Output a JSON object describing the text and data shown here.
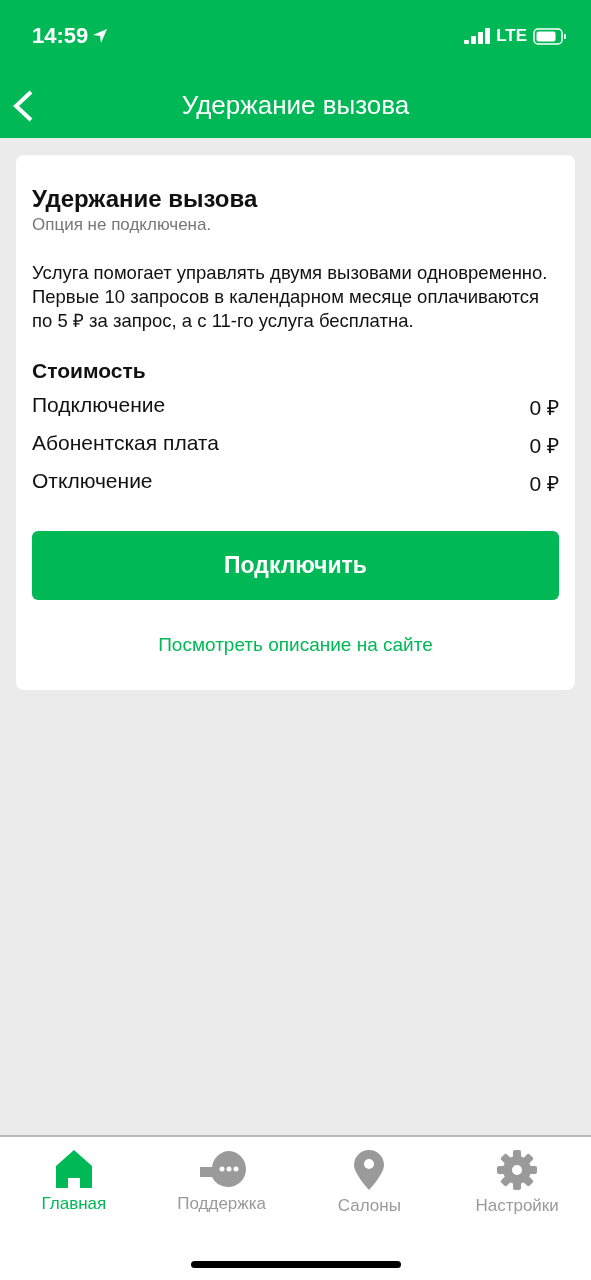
{
  "status_bar": {
    "time": "14:59",
    "network": "LTE"
  },
  "nav": {
    "title": "Удержание вызова"
  },
  "card": {
    "title": "Удержание вызова",
    "status": "Опция не подключена.",
    "description": "Услуга помогает управлять двумя вызовами одновременно. Первые 10 запросов в календарном месяце оплачиваются по 5 ₽ за запрос, а с 11-го услуга бесплатна.",
    "cost_title": "Стоимость",
    "costs": [
      {
        "label": "Подключение",
        "value": "0 ₽"
      },
      {
        "label": "Абонентская плата",
        "value": "0 ₽"
      },
      {
        "label": "Отключение",
        "value": "0 ₽"
      }
    ],
    "button": "Подключить",
    "link": "Посмотреть описание на сайте"
  },
  "tabs": [
    {
      "kind": "home",
      "label": "Главная",
      "selected": true
    },
    {
      "kind": "support",
      "label": "Поддержка",
      "selected": false
    },
    {
      "kind": "pin",
      "label": "Салоны",
      "selected": false
    },
    {
      "kind": "gear",
      "label": "Настройки",
      "selected": false
    }
  ]
}
